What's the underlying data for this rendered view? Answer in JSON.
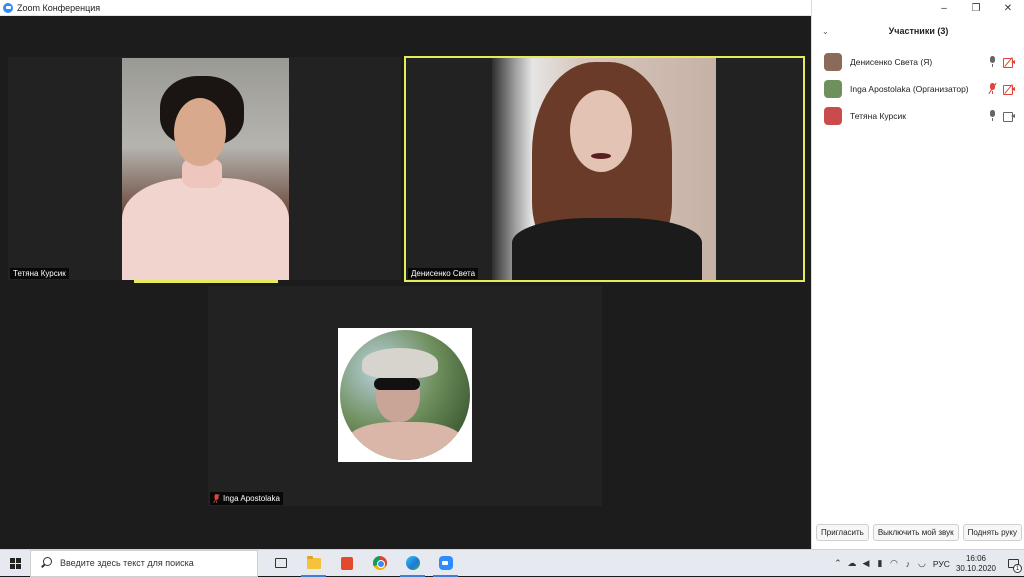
{
  "window": {
    "title": "Zoom Конференция"
  },
  "tiles": [
    {
      "name": "Тетяна Курсик",
      "active": false
    },
    {
      "name": "Денисенко Света",
      "active": true
    },
    {
      "name": "Inga Apostolaka",
      "muted": true
    }
  ],
  "panel": {
    "title": "Участники (3)",
    "participants": [
      {
        "name": "Денисенко Света (Я)",
        "mic": "on",
        "video": "off",
        "avatar_color": "#8c6a5a"
      },
      {
        "name": "Inga Apostolaka (Организатор)",
        "mic": "muted",
        "video": "off",
        "avatar_color": "#6f8f5d"
      },
      {
        "name": "Тетяна Курсик",
        "mic": "on",
        "video": "on",
        "avatar_color": "#c94b4b"
      }
    ],
    "buttons": {
      "invite": "Пригласить",
      "mute_me": "Выключить мой звук",
      "raise_hand": "Поднять руку"
    }
  },
  "taskbar": {
    "search_placeholder": "Введите здесь текст для поиска",
    "language": "РУС",
    "time": "16:06",
    "date": "30.10.2020",
    "notification_count": "1"
  },
  "window_controls": {
    "minimize": "–",
    "restore": "❐",
    "close": "✕"
  },
  "colors": {
    "active_speaker": "#e6ea5f",
    "zoom_blue": "#2d8cff",
    "muted_red": "#e0453b"
  }
}
